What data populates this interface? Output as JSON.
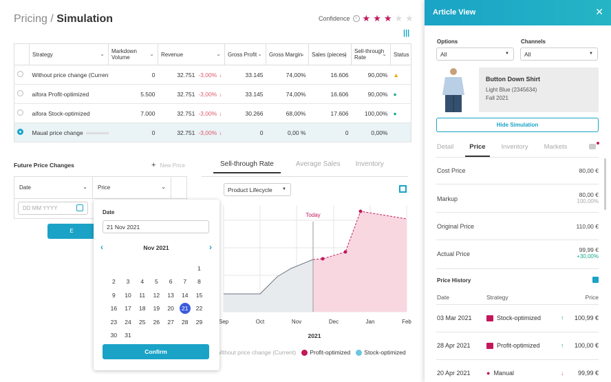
{
  "header": {
    "title_prefix": "Pricing / ",
    "title_main": "Simulation",
    "confidence_label": "Confidence",
    "stars_filled": 3,
    "stars_total": 5
  },
  "table": {
    "columns": [
      "Strategy",
      "Markdown Volume",
      "Revenue",
      "Gross Profit",
      "Gross Margin",
      "Sales (pieces)",
      "Sell-through Rate",
      "Status"
    ],
    "rows": [
      {
        "strategy": "Without price change (Current)",
        "markdown": "0",
        "revenue": "32.751",
        "delta": "-3,00%",
        "gross_profit": "33.145",
        "gross_margin": "74,00%",
        "sales": "16.606",
        "sell_through": "90,00%"
      },
      {
        "strategy": "aifora Profit-optimized",
        "markdown": "5.500",
        "revenue": "32.751",
        "delta": "-3,00%",
        "gross_profit": "33.145",
        "gross_margin": "74,00%",
        "sales": "16.606",
        "sell_through": "90,00%"
      },
      {
        "strategy": "aifora Stock-optimized",
        "markdown": "7.000",
        "revenue": "32.751",
        "delta": "-3,00%",
        "gross_profit": "30.266",
        "gross_margin": "68,00%",
        "sales": "17.606",
        "sell_through": "100,00%"
      },
      {
        "strategy": "Maual price change",
        "markdown": "0",
        "revenue": "32.751",
        "delta": "-3,00%",
        "gross_profit": "0",
        "gross_margin": "0,00 %",
        "sales": "0",
        "sell_through": "0,00%"
      }
    ]
  },
  "future": {
    "title": "Future Price Changes",
    "new_price": "New Price",
    "col_date": "Date",
    "col_price": "Price",
    "date_placeholder": "DD MM YYYY",
    "button": "E"
  },
  "datepicker": {
    "label": "Date",
    "value": "21 Nov 2021",
    "month": "Nov 2021",
    "confirm": "Confirm",
    "weeks": [
      [
        "",
        "",
        "",
        "",
        "",
        "",
        "1"
      ],
      [
        "2",
        "3",
        "4",
        "5",
        "6",
        "7",
        "8"
      ],
      [
        "9",
        "10",
        "11",
        "12",
        "13",
        "14",
        "15"
      ],
      [
        "16",
        "17",
        "18",
        "19",
        "20",
        "21",
        "22"
      ],
      [
        "23",
        "24",
        "25",
        "26",
        "27",
        "28",
        "29"
      ],
      [
        "30",
        "31",
        "",
        "",
        "",
        "",
        ""
      ]
    ],
    "selected": "21"
  },
  "chart_tabs": [
    "Sell-through Rate",
    "Average Sales",
    "Inventory"
  ],
  "chart_select": "Product Lifecycle",
  "chart_data": {
    "type": "line",
    "x_ticks": [
      "Sep",
      "Oct",
      "Nov",
      "Dec",
      "Jan",
      "Feb"
    ],
    "xlabel": "2021",
    "today_label": "Today",
    "series": [
      {
        "name": "Without price change (Current)",
        "color": "#9aa4ad"
      },
      {
        "name": "Profit-optimized",
        "color": "#c2185b"
      },
      {
        "name": "Stock-optimized",
        "color": "#6cc6df"
      }
    ]
  },
  "panel": {
    "title": "Article View",
    "options_label": "Options",
    "options_value": "All",
    "channels_label": "Channels",
    "channels_value": "All",
    "product_name": "Button Down Shirt",
    "product_color": "Light Blue (2345634)",
    "product_season": "Fall 2021",
    "hide_button": "Hide Simulation",
    "tabs": [
      "Detail",
      "Price",
      "Inventory",
      "Markets"
    ],
    "prices": [
      {
        "label": "Cost Price",
        "value": "80,00 €",
        "sub": ""
      },
      {
        "label": "Markup",
        "value": "80,00 €",
        "sub": "100,00%"
      },
      {
        "label": "Original Price",
        "value": "110,00 €",
        "sub": ""
      },
      {
        "label": "Actual Price",
        "value": "99,99 €",
        "sub": "+30,00%"
      }
    ],
    "history_title": "Price History",
    "history_cols": [
      "Date",
      "Strategy",
      "Price"
    ],
    "history": [
      {
        "date": "03 Mar 2021",
        "strategy": "Stock-optimized",
        "dir": "↑",
        "price": "100,99 €"
      },
      {
        "date": "28 Apr 2021",
        "strategy": "Profit-optimized",
        "dir": "↑",
        "price": "100,00 €"
      },
      {
        "date": "20 Apr 2021",
        "strategy": "Manual",
        "dir": "↓",
        "price": "99,99 €"
      }
    ]
  }
}
